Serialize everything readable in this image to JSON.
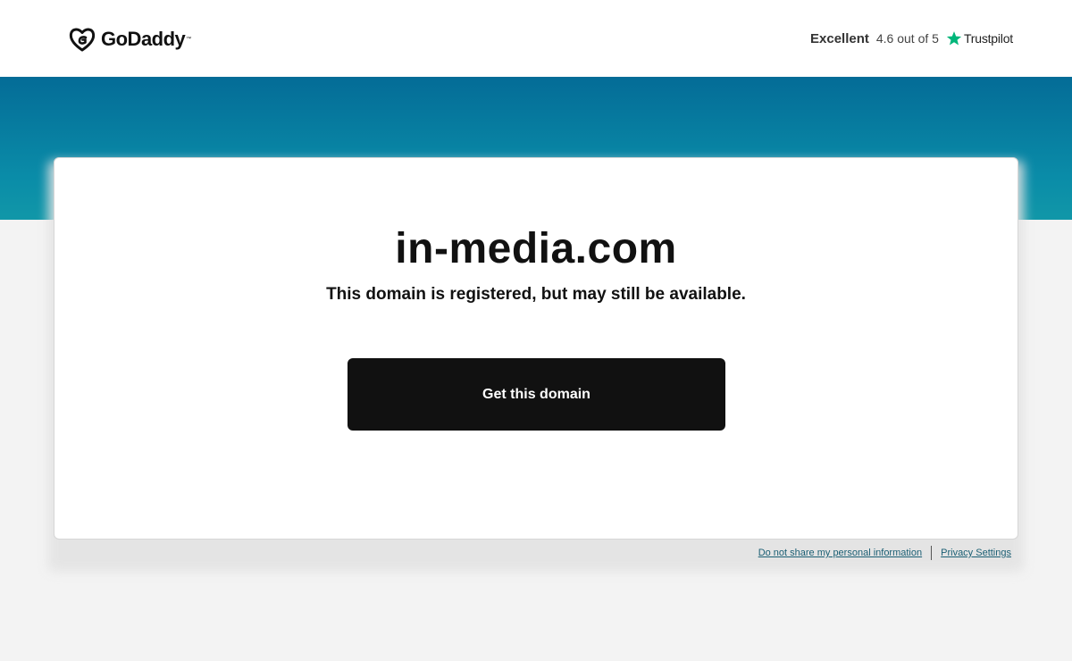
{
  "header": {
    "logo_text": "GoDaddy",
    "logo_tm": "™",
    "rating_word": "Excellent",
    "rating_score": "4.6 out of 5",
    "trustpilot_label": "Trustpilot",
    "trustpilot_color": "#00b67a"
  },
  "colors": {
    "band_top": "#046c97",
    "band_bottom": "#1197a8",
    "button_bg": "#111111",
    "link": "#1a5e73"
  },
  "main": {
    "domain": "in-media.com",
    "message": "This domain is registered, but may still be available.",
    "cta_label": "Get this domain"
  },
  "footer": {
    "links": [
      "Do not share my personal information",
      "Privacy Settings"
    ]
  }
}
